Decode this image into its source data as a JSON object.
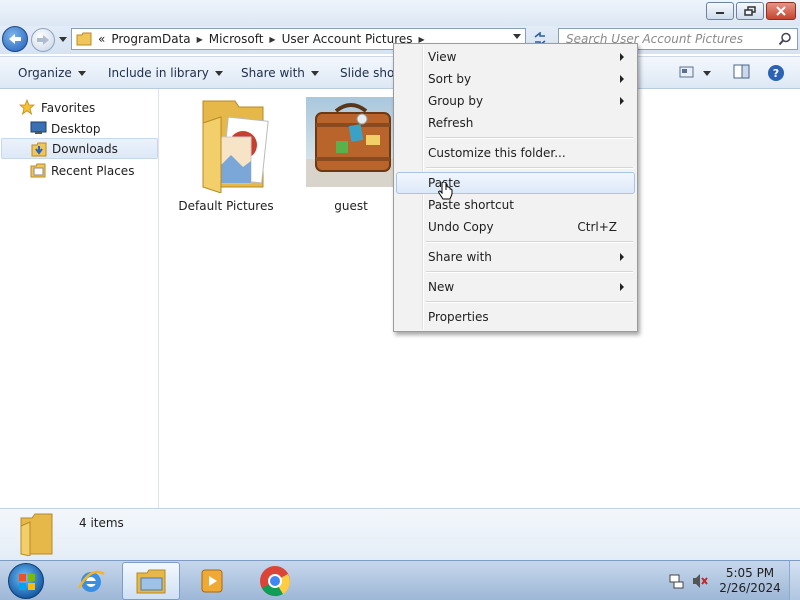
{
  "window": {
    "minimize_icon": "minimize-icon",
    "maximize_icon": "maximize-icon",
    "close_icon": "close-icon"
  },
  "address": {
    "overflow": "«",
    "crumbs": [
      "ProgramData",
      "Microsoft",
      "User Account Pictures"
    ],
    "search_placeholder": "Search User Account Pictures"
  },
  "toolbar": {
    "organize": "Organize",
    "include_in_library": "Include in library",
    "share_with": "Share with",
    "slide_show": "Slide show"
  },
  "nav": {
    "favorites": "Favorites",
    "items": [
      {
        "label": "Desktop",
        "icon": "desktop-icon"
      },
      {
        "label": "Downloads",
        "icon": "downloads-folder-icon",
        "selected": true
      },
      {
        "label": "Recent Places",
        "icon": "recent-places-icon"
      }
    ]
  },
  "files": [
    {
      "name": "Default Pictures",
      "icon": "pictures-folder-icon"
    },
    {
      "name": "guest",
      "icon": "suitcase-thumbnail"
    }
  ],
  "details": {
    "count": "4 items"
  },
  "context_menu": {
    "items": [
      {
        "label": "View",
        "submenu": true
      },
      {
        "label": "Sort by",
        "submenu": true
      },
      {
        "label": "Group by",
        "submenu": true
      },
      {
        "label": "Refresh"
      },
      {
        "label": "Customize this folder..."
      },
      {
        "label": "Paste",
        "hover": true
      },
      {
        "label": "Paste shortcut"
      },
      {
        "label": "Undo Copy",
        "shortcut": "Ctrl+Z"
      },
      {
        "label": "Share with",
        "submenu": true
      },
      {
        "label": "New",
        "submenu": true
      },
      {
        "label": "Properties"
      }
    ]
  },
  "taskbar": {
    "time": "5:05 PM",
    "date": "2/26/2024"
  }
}
